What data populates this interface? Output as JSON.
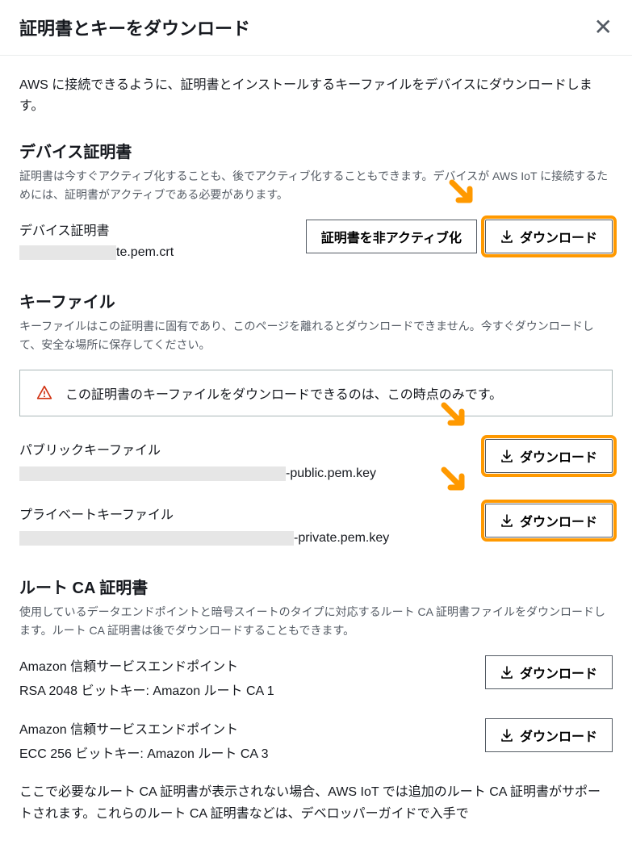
{
  "header": {
    "title": "証明書とキーをダウンロード"
  },
  "intro": "AWS に接続できるように、証明書とインストールするキーファイルをデバイスにダウンロードします。",
  "deviceCert": {
    "title": "デバイス証明書",
    "desc": "証明書は今すぐアクティブ化することも、後でアクティブ化することもできます。デバイスが AWS IoT に接続するためには、証明書がアクティブである必要があります。",
    "label": "デバイス証明書",
    "filenameSuffix": "te.pem.crt",
    "deactivateBtn": "証明書を非アクティブ化",
    "downloadBtn": "ダウンロード"
  },
  "keyFiles": {
    "title": "キーファイル",
    "desc": "キーファイルはこの証明書に固有であり、このページを離れるとダウンロードできません。今すぐダウンロードして、安全な場所に保存してください。",
    "alert": "この証明書のキーファイルをダウンロードできるのは、この時点のみです。",
    "publicLabel": "パブリックキーファイル",
    "publicSuffix": "-public.pem.key",
    "privateLabel": "プライベートキーファイル",
    "privateSuffix": "-private.pem.key",
    "downloadBtn": "ダウンロード"
  },
  "rootCA": {
    "title": "ルート CA 証明書",
    "desc": "使用しているデータエンドポイントと暗号スイートのタイプに対応するルート CA 証明書ファイルをダウンロードします。ルート CA 証明書は後でダウンロードすることもできます。",
    "ca1Label": "Amazon 信頼サービスエンドポイント",
    "ca1Sub": "RSA 2048 ビットキー: Amazon ルート CA 1",
    "ca3Label": "Amazon 信頼サービスエンドポイント",
    "ca3Sub": "ECC 256 ビットキー: Amazon ルート CA 3",
    "downloadBtn": "ダウンロード",
    "footer": "ここで必要なルート CA 証明書が表示されない場合、AWS IoT では追加のルート CA 証明書がサポートされます。これらのルート CA 証明書などは、デベロッパーガイドで入手で"
  }
}
